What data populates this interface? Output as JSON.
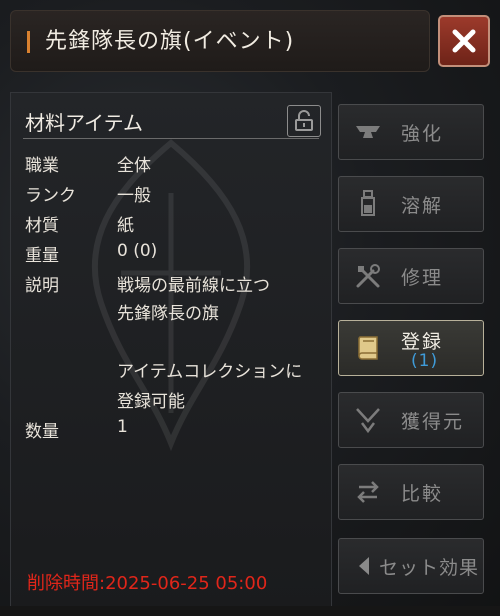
{
  "window": {
    "title": "先鋒隊長の旗(イベント)"
  },
  "item": {
    "section_title": "材料アイテム",
    "rows": [
      {
        "label": "職業",
        "value": "全体"
      },
      {
        "label": "ランク",
        "value": "一般"
      },
      {
        "label": "材質",
        "value": "紙"
      },
      {
        "label": "重量",
        "value": "0 (0)"
      },
      {
        "label": "説明",
        "value": "戦場の最前線に立つ"
      }
    ],
    "description_line2": "先鋒隊長の旗",
    "description_line3": "アイテムコレクションに",
    "description_line4": "登録可能",
    "quantity_label": "数量",
    "quantity_value": "1",
    "delete_time": "削除時間:2025-06-25  05:00"
  },
  "actions": {
    "enhance": "強化",
    "dissolve": "溶解",
    "repair": "修理",
    "register": "登録",
    "register_count": "(1)",
    "source": "獲得元",
    "compare": "比較",
    "set_effect": "セット効果"
  },
  "colors": {
    "accent": "#d9812f",
    "delete_text": "#e0261a",
    "count_text": "#3f9bd8"
  }
}
